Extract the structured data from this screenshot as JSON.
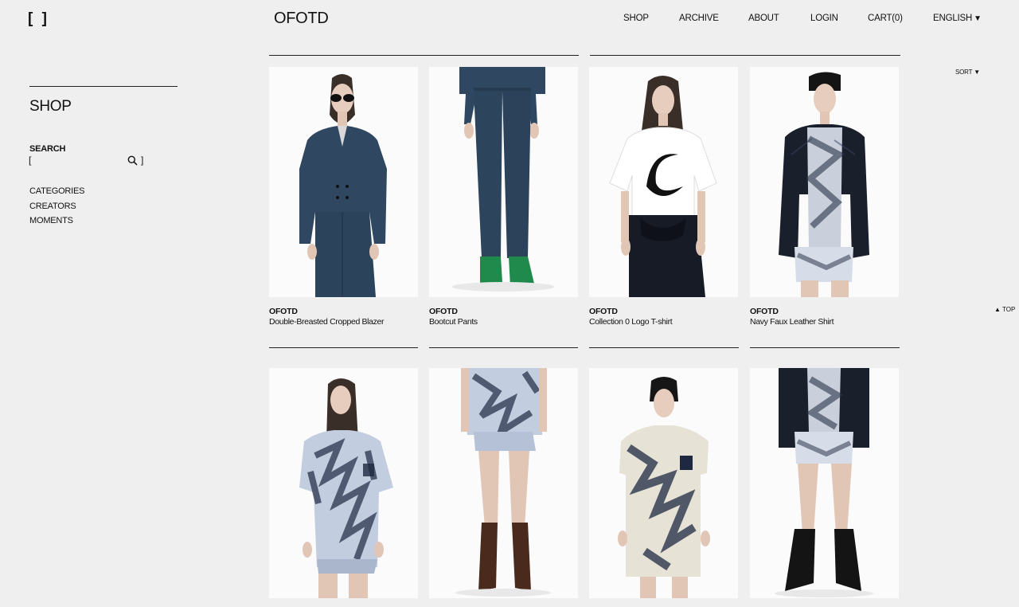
{
  "header": {
    "logo": "[ ]",
    "brand": "OFOTD",
    "nav": [
      {
        "label": "SHOP"
      },
      {
        "label": "ARCHIVE"
      },
      {
        "label": "ABOUT"
      },
      {
        "label": "LOGIN"
      },
      {
        "label": "CART(0)"
      },
      {
        "label": "ENGLISH",
        "icon": "caret-down-icon"
      }
    ]
  },
  "sidebar": {
    "title": "SHOP",
    "search": {
      "label": "SEARCH",
      "value": "",
      "placeholder": "",
      "open_bracket": "[",
      "close_bracket": "]",
      "icon": "search-icon"
    },
    "links": [
      {
        "label": "CATEGORIES"
      },
      {
        "label": "CREATORS"
      },
      {
        "label": "MOMENTS"
      }
    ]
  },
  "sort": {
    "label": "SORT",
    "icon": "caret-down-icon"
  },
  "to_top": {
    "label": "TOP",
    "icon": "caret-up-icon"
  },
  "products": [
    {
      "brand": "OFOTD",
      "name": "Double-Breasted Cropped Blazer"
    },
    {
      "brand": "OFOTD",
      "name": "Bootcut Pants"
    },
    {
      "brand": "OFOTD",
      "name": "Collection 0 Logo T-shirt"
    },
    {
      "brand": "OFOTD",
      "name": "Navy Faux Leather Shirt"
    },
    {
      "brand": "",
      "name": ""
    },
    {
      "brand": "",
      "name": ""
    },
    {
      "brand": "",
      "name": ""
    },
    {
      "brand": "",
      "name": ""
    }
  ]
}
